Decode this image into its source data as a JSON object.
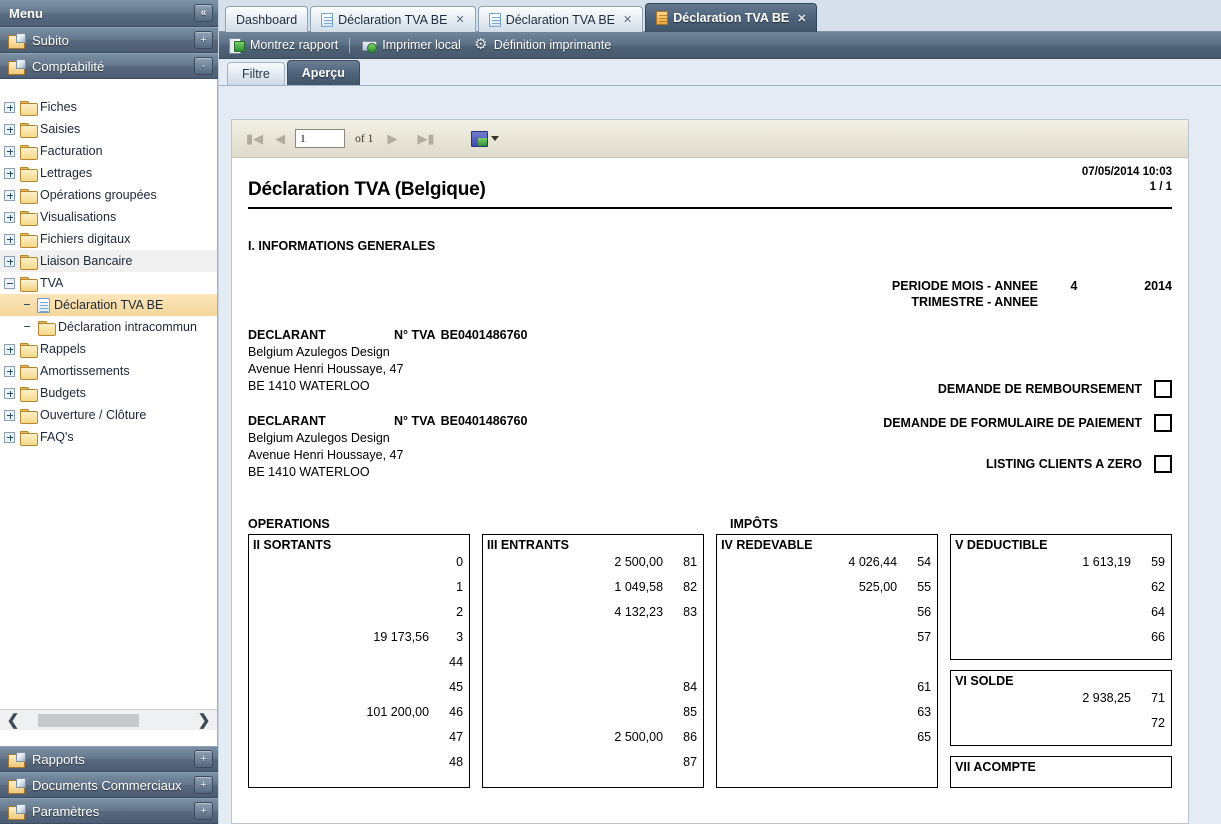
{
  "sidebar": {
    "title": "Menu",
    "collapse_icon": "chevron-double-left-icon",
    "groups_top": [
      {
        "label": "Subito",
        "btn": "+"
      },
      {
        "label": "Comptabilité",
        "btn": "-"
      }
    ],
    "tree": [
      {
        "label": "Fiches",
        "state": "collapsed",
        "level": 0,
        "icon": "folder-icon"
      },
      {
        "label": "Saisies",
        "state": "collapsed",
        "level": 0,
        "icon": "folder-icon"
      },
      {
        "label": "Facturation",
        "state": "collapsed",
        "level": 0,
        "icon": "folder-icon"
      },
      {
        "label": "Lettrages",
        "state": "collapsed",
        "level": 0,
        "icon": "folder-icon"
      },
      {
        "label": "Opérations groupées",
        "state": "collapsed",
        "level": 0,
        "icon": "folder-icon"
      },
      {
        "label": "Visualisations",
        "state": "collapsed",
        "level": 0,
        "icon": "folder-icon"
      },
      {
        "label": "Fichiers digitaux",
        "state": "collapsed",
        "level": 0,
        "icon": "folder-icon"
      },
      {
        "label": "Liaison Bancaire",
        "state": "collapsed",
        "level": 0,
        "icon": "folder-icon",
        "hover": true
      },
      {
        "label": "TVA",
        "state": "expanded",
        "level": 0,
        "icon": "folder-open-icon"
      },
      {
        "label": "Déclaration TVA BE",
        "state": "leaf",
        "level": 1,
        "icon": "page-icon",
        "selected": true
      },
      {
        "label": "Déclaration intracommun",
        "state": "leaf",
        "level": 1,
        "icon": "folder-icon"
      },
      {
        "label": "Rappels",
        "state": "collapsed",
        "level": 0,
        "icon": "folder-icon"
      },
      {
        "label": "Amortissements",
        "state": "collapsed",
        "level": 0,
        "icon": "folder-icon"
      },
      {
        "label": "Budgets",
        "state": "collapsed",
        "level": 0,
        "icon": "folder-icon"
      },
      {
        "label": "Ouverture / Clôture",
        "state": "collapsed",
        "level": 0,
        "icon": "folder-icon"
      },
      {
        "label": "FAQ's",
        "state": "collapsed",
        "level": 0,
        "icon": "folder-icon"
      }
    ],
    "scroll": {
      "left_icon": "chevron-left-icon",
      "right_icon": "chevron-right-icon"
    },
    "groups_bottom": [
      {
        "label": "Rapports",
        "btn": "+"
      },
      {
        "label": "Documents Commerciaux",
        "btn": "+"
      },
      {
        "label": "Paramètres",
        "btn": "+"
      }
    ]
  },
  "tabs": [
    {
      "label": "Dashboard",
      "icon": null,
      "closable": false,
      "active": false
    },
    {
      "label": "Déclaration TVA BE",
      "icon": "page-icon",
      "closable": true,
      "active": false
    },
    {
      "label": "Déclaration TVA BE",
      "icon": "page-icon",
      "closable": true,
      "active": false
    },
    {
      "label": "Déclaration TVA BE",
      "icon": "page-icon",
      "closable": true,
      "active": true
    }
  ],
  "commandbar": [
    {
      "label": "Montrez rapport",
      "icon": "report-icon"
    },
    {
      "label": "Imprimer local",
      "icon": "print-icon"
    },
    {
      "label": "Définition imprimante",
      "icon": "gear-icon"
    }
  ],
  "subtabs": [
    {
      "label": "Filtre",
      "active": false
    },
    {
      "label": "Aperçu",
      "active": true
    }
  ],
  "report_toolbar": {
    "first_icon": "first-page-icon",
    "prev_icon": "prev-page-icon",
    "page_value": "1",
    "of_label": "of 1",
    "next_icon": "next-page-icon",
    "last_icon": "last-page-icon",
    "export_icon": "save-export-icon",
    "export_caret": "chevron-down-icon"
  },
  "report": {
    "datetime": "07/05/2014 10:03",
    "pageno": "1 / 1",
    "title": "Déclaration TVA (Belgique)",
    "section1": "I. INFORMATIONS GENERALES",
    "period": {
      "label_mois": "PERIODE MOIS - ANNEE",
      "label_trim": "TRIMESTRE - ANNEE",
      "mois": "4",
      "annee": "2014",
      "trim_mois": "",
      "trim_annee": ""
    },
    "declarants": [
      {
        "title": "DECLARANT",
        "tva_label": "N° TVA",
        "tva_number": "BE0401486760",
        "name": "Belgium Azulegos Design",
        "street": "Avenue Henri Houssaye, 47",
        "city": "BE 1410 WATERLOO"
      },
      {
        "title": "DECLARANT",
        "tva_label": "N° TVA",
        "tva_number": "BE0401486760",
        "name": "Belgium Azulegos Design",
        "street": "Avenue Henri Houssaye, 47",
        "city": "BE 1410 WATERLOO"
      }
    ],
    "checkboxes": [
      {
        "label": "DEMANDE DE REMBOURSEMENT",
        "checked": false
      },
      {
        "label": "DEMANDE DE FORMULAIRE DE PAIEMENT",
        "checked": false
      },
      {
        "label": "LISTING CLIENTS A ZERO",
        "checked": false
      }
    ],
    "col_headers": {
      "left": "OPERATIONS",
      "right": "IMPÔTS"
    },
    "boxes": {
      "sortants": {
        "title": "II SORTANTS",
        "rows": [
          {
            "amount": "",
            "code": "0"
          },
          {
            "amount": "",
            "code": "1"
          },
          {
            "amount": "",
            "code": "2"
          },
          {
            "amount": "19 173,56",
            "code": "3"
          },
          {
            "amount": "",
            "code": "44"
          },
          {
            "amount": "",
            "code": "45"
          },
          {
            "amount": "101 200,00",
            "code": "46"
          },
          {
            "amount": "",
            "code": "47"
          },
          {
            "amount": "",
            "code": "48"
          }
        ]
      },
      "entrants": {
        "title": "III ENTRANTS",
        "rows": [
          {
            "amount": "2 500,00",
            "code": "81"
          },
          {
            "amount": "1 049,58",
            "code": "82"
          },
          {
            "amount": "4 132,23",
            "code": "83"
          },
          {
            "amount": "",
            "code": ""
          },
          {
            "amount": "",
            "code": ""
          },
          {
            "amount": "",
            "code": "84"
          },
          {
            "amount": "",
            "code": "85"
          },
          {
            "amount": "2 500,00",
            "code": "86"
          },
          {
            "amount": "",
            "code": "87"
          }
        ]
      },
      "redevable": {
        "title": "IV REDEVABLE",
        "rows": [
          {
            "amount": "4 026,44",
            "code": "54"
          },
          {
            "amount": "525,00",
            "code": "55"
          },
          {
            "amount": "",
            "code": "56"
          },
          {
            "amount": "",
            "code": "57"
          },
          {
            "amount": "",
            "code": ""
          },
          {
            "amount": "",
            "code": "61"
          },
          {
            "amount": "",
            "code": "63"
          },
          {
            "amount": "",
            "code": "65"
          }
        ]
      },
      "deductible": {
        "title": "V DEDUCTIBLE",
        "rows": [
          {
            "amount": "1 613,19",
            "code": "59"
          },
          {
            "amount": "",
            "code": "62"
          },
          {
            "amount": "",
            "code": "64"
          },
          {
            "amount": "",
            "code": "66"
          }
        ]
      },
      "solde": {
        "title": "VI SOLDE",
        "rows": [
          {
            "amount": "2 938,25",
            "code": "71"
          },
          {
            "amount": "",
            "code": "72"
          }
        ]
      },
      "acompte": {
        "title": "VII ACOMPTE",
        "rows": []
      }
    }
  }
}
